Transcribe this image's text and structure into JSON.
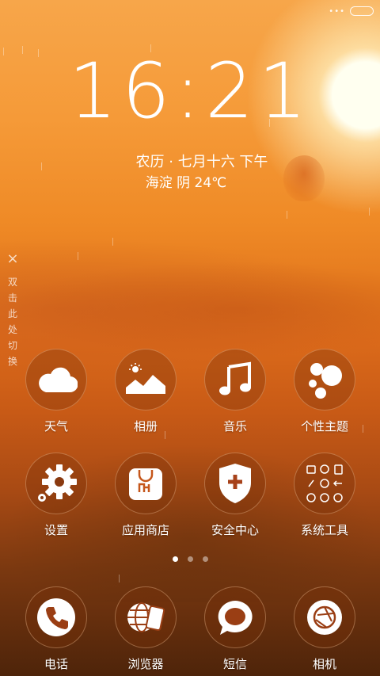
{
  "status": {
    "dots": "•••"
  },
  "clock": {
    "hh": "16",
    "mm": "21"
  },
  "date_line": "农历 · 七月十六  下午",
  "weather_line": "海淀  阴  24℃",
  "hint": {
    "close": "×",
    "text": "双击此处切换"
  },
  "apps_row1": [
    {
      "label": "天气",
      "icon": "cloud-icon"
    },
    {
      "label": "相册",
      "icon": "mountain-sun-icon"
    },
    {
      "label": "音乐",
      "icon": "music-note-icon"
    },
    {
      "label": "个性主题",
      "icon": "theme-bubbles-icon"
    }
  ],
  "apps_row2": [
    {
      "label": "设置",
      "icon": "gear-icon"
    },
    {
      "label": "应用商店",
      "icon": "store-bag-icon"
    },
    {
      "label": "安全中心",
      "icon": "shield-plus-icon"
    },
    {
      "label": "系统工具",
      "icon": "tools-grid-icon"
    }
  ],
  "pager": {
    "count": 3,
    "active": 0
  },
  "dock": [
    {
      "label": "电话",
      "icon": "phone-icon"
    },
    {
      "label": "浏览器",
      "icon": "globe-phone-icon"
    },
    {
      "label": "短信",
      "icon": "chat-bubble-icon"
    },
    {
      "label": "相机",
      "icon": "camera-lens-icon"
    }
  ],
  "colors": {
    "sky_top": "#f7a64a",
    "sky_mid": "#e57a1e",
    "ground": "#4e240a",
    "text": "#ffffff"
  }
}
